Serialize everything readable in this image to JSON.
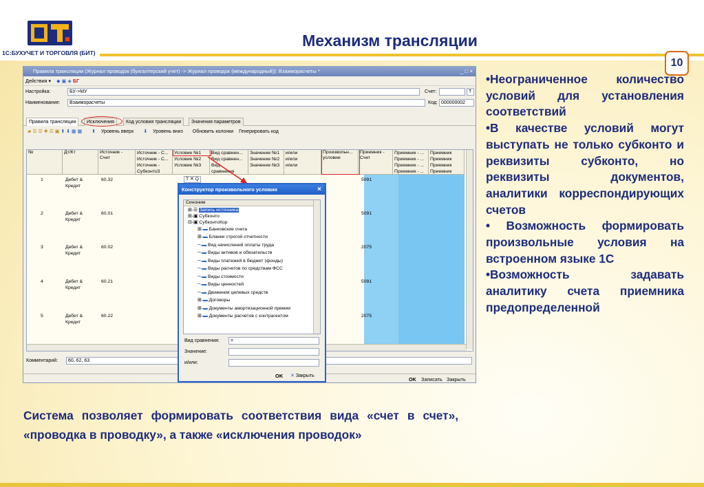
{
  "slide": {
    "title": "Механизм трансляции",
    "logo_text": "1С:БУХУЧЕТ И ТОРГОВЛЯ (БИТ)",
    "page_number": "10",
    "right_bullets": [
      "•Неограниченное количество условий для установления соответствий",
      "•В качестве условий могут выступать не только субконто и реквизиты субконто, но реквизиты документов, аналитики корреспондирующих счетов",
      "• Возможность формировать произвольные условия на встроенном языке 1С",
      "•Возможность задавать аналитику счета приемника предопределенной"
    ],
    "bottom_text": "Система позволяет формировать соответствия вида «счет в счет», «проводка в проводку», а также «исключения проводок»"
  },
  "window": {
    "title": "Правила трансляции (Журнал проводок (бухгалтерский учет) -> Журнал проводок (международный)): Взаиморасчеты *",
    "controls": "_ □ ×",
    "menu": [
      "Действия ▾"
    ],
    "fields": {
      "settings_label": "Настройка:",
      "settings_value": "БУ->МУ",
      "account_label": "Счет:",
      "account_value": "",
      "account_button": "Т",
      "name_label": "Наименование:",
      "name_value": "Взаиморасчеты",
      "code_label": "Код:",
      "code_value": "000000002"
    },
    "tabs": [
      "Правила трансляции",
      "Исключения",
      "Код условия трансляции",
      "Значения параметров"
    ],
    "toolbar": [
      "Уровень вверх",
      "Уровень вниз",
      "Обновить колонки",
      "Генерировать код"
    ],
    "grid_headers": {
      "num": "№",
      "dtkt": "Дт/Кт",
      "source_account": [
        "Источник -",
        "Счет"
      ],
      "source_subconto": [
        "Источник - С...",
        "Источник - С...",
        "Источник -",
        "Субконто3"
      ],
      "condition": [
        "Условие №1",
        "Условие №2",
        "Условие №3"
      ],
      "compare": [
        "Вид сравнен...",
        "Вид сравнен...",
        "Вид",
        "сравнения"
      ],
      "value": [
        "Значение №1",
        "Значение №2",
        "Значение №3"
      ],
      "andor": [
        "и/или",
        "и/или",
        "и/или"
      ],
      "custom": [
        "Произвольн...",
        "условие"
      ],
      "receiver_account": [
        "Приемник -",
        "Счет"
      ],
      "receiver1": [
        "Приемник - ...",
        "Приемник - ...",
        "Приемник - ...",
        "Приемник - ..."
      ],
      "receiver2": [
        "Приемник",
        "Приемник",
        "Приемник",
        "Приемник"
      ]
    },
    "rows": [
      {
        "num": "1",
        "dtkt": [
          "Дебет &",
          "Кредит"
        ],
        "account": "60.32",
        "receiver": "5091"
      },
      {
        "num": "2",
        "dtkt": [
          "Дебет &",
          "Кредит"
        ],
        "account": "60.01",
        "receiver": "5091"
      },
      {
        "num": "3",
        "dtkt": [
          "Дебет &",
          "Кредит"
        ],
        "account": "60.02",
        "receiver": "2075"
      },
      {
        "num": "4",
        "dtkt": [
          "Дебет &",
          "Кредит"
        ],
        "account": "60.21",
        "receiver": "5091"
      },
      {
        "num": "5",
        "dtkt": [
          "Дебет &",
          "Кредит"
        ],
        "account": "60.22",
        "receiver": "2075"
      }
    ],
    "cell_editor": "Т ✕ Q",
    "comment_label": "Комментарий:",
    "comment_value": "60, 62, 63",
    "buttons": {
      "ok": "OK",
      "save": "Записать",
      "close": "Закрыть"
    }
  },
  "dialog": {
    "title": "Конструктор произвольного условия",
    "close": "×",
    "tree_header": "Синоним",
    "tree": [
      {
        "label": "Запись источника",
        "level": 0,
        "selected": true
      },
      {
        "label": "Субконто",
        "level": 0
      },
      {
        "label": "СубконтоКор",
        "level": 0
      },
      {
        "label": "Банковские счета",
        "level": 1
      },
      {
        "label": "Бланки строгой отчетности",
        "level": 1
      },
      {
        "label": "Вид начислений оплаты труда",
        "level": 1
      },
      {
        "label": "Виды активов и обязательств",
        "level": 1
      },
      {
        "label": "Виды платежей в бюджет (фонды)",
        "level": 1
      },
      {
        "label": "Виды расчетов по средствам ФСС",
        "level": 1
      },
      {
        "label": "Виды стоимости",
        "level": 1
      },
      {
        "label": "Виды ценностей",
        "level": 1
      },
      {
        "label": "Движения целевых средств",
        "level": 1
      },
      {
        "label": "Договоры",
        "level": 1
      },
      {
        "label": "Документы амортизационной премии",
        "level": 1
      },
      {
        "label": "Документы расчетов с контрагентом",
        "level": 1
      }
    ],
    "compare_label": "Вид сравнения:",
    "compare_value": "=",
    "value_label": "Значение:",
    "value_value": "",
    "andor_label": "и/или:",
    "andor_value": "",
    "ok": "OK",
    "close_button": "Закрыть"
  }
}
